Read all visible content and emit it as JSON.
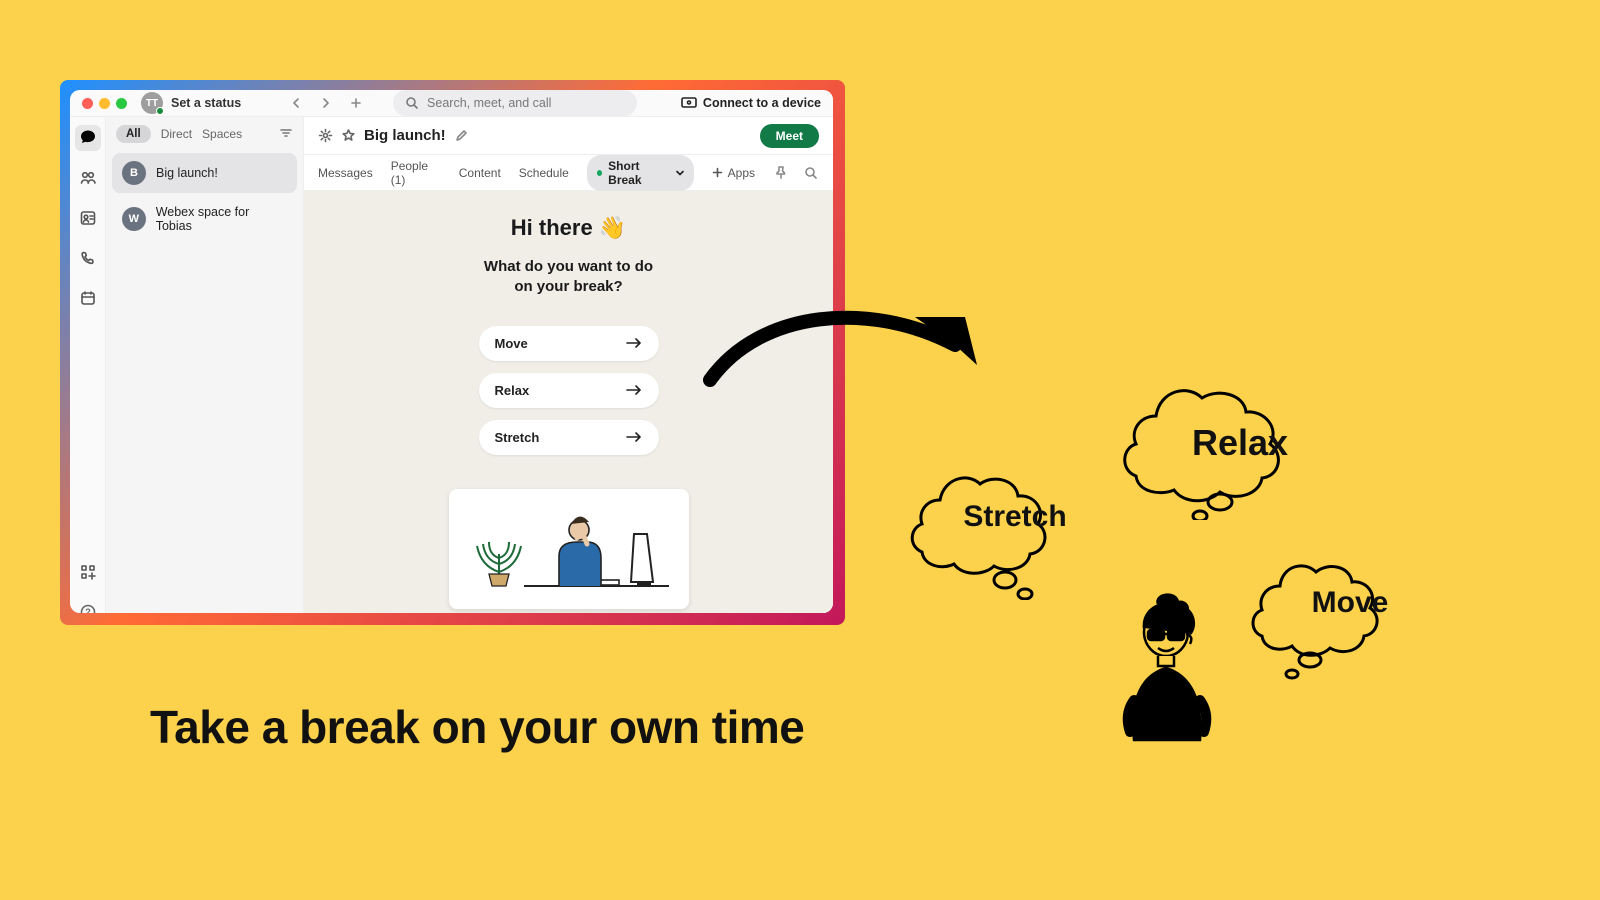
{
  "topbar": {
    "avatar_initials": "TT",
    "status_text": "Set a status",
    "search_placeholder": "Search, meet, and call",
    "connect_label": "Connect to a device"
  },
  "list": {
    "filter_all": "All",
    "filter_direct": "Direct",
    "filter_spaces": "Spaces",
    "items": [
      {
        "initial": "B",
        "name": "Big launch!"
      },
      {
        "initial": "W",
        "name": "Webex space for Tobias"
      }
    ]
  },
  "header": {
    "space_title": "Big launch!",
    "meet": "Meet"
  },
  "tabs": {
    "messages": "Messages",
    "people": "People (1)",
    "content": "Content",
    "schedule": "Schedule",
    "active_app": "Short Break",
    "apps": "Apps"
  },
  "panel": {
    "greeting": "Hi there 👋",
    "question_l1": "What do you want to do",
    "question_l2": "on your break?",
    "options": [
      "Move",
      "Relax",
      "Stretch"
    ]
  },
  "promo": {
    "tagline": "Take a break on your own time",
    "bubble_stretch": "Stretch",
    "bubble_relax": "Relax",
    "bubble_move": "Move"
  }
}
